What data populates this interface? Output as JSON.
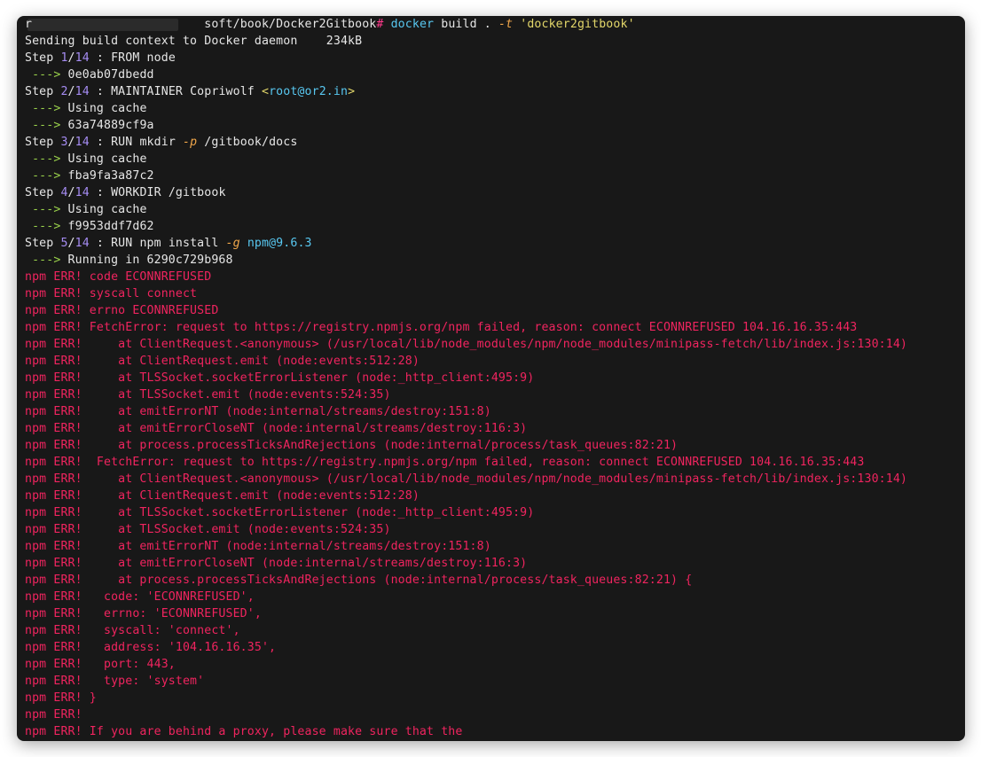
{
  "terminal": {
    "prompt": {
      "user_marker": "r",
      "path": "soft/book/Docker2Gitbook",
      "symbol": "#",
      "command": "docker",
      "args": " build . ",
      "flag": "-t",
      "tag": "'docker2gitbook'"
    },
    "lines": [
      [
        {
          "t": "Sending build context to Docker daemon    234kB",
          "c": "white"
        }
      ],
      [
        {
          "t": "Step ",
          "c": "white"
        },
        {
          "t": "1",
          "c": "purple"
        },
        {
          "t": "/",
          "c": "white"
        },
        {
          "t": "14",
          "c": "purple"
        },
        {
          "t": " : FROM node",
          "c": "white"
        }
      ],
      [
        {
          "t": " ---> ",
          "c": "green"
        },
        {
          "t": "0e0ab07dbedd",
          "c": "white"
        }
      ],
      [
        {
          "t": "Step ",
          "c": "white"
        },
        {
          "t": "2",
          "c": "purple"
        },
        {
          "t": "/",
          "c": "white"
        },
        {
          "t": "14",
          "c": "purple"
        },
        {
          "t": " : MAINTAINER Copriwolf ",
          "c": "white"
        },
        {
          "t": "<",
          "c": "yellow"
        },
        {
          "t": "root@or2.in",
          "c": "cyan"
        },
        {
          "t": ">",
          "c": "yellow"
        }
      ],
      [
        {
          "t": " ---> ",
          "c": "green"
        },
        {
          "t": "Using cache",
          "c": "white"
        }
      ],
      [
        {
          "t": " ---> ",
          "c": "green"
        },
        {
          "t": "63a74889cf9a",
          "c": "white"
        }
      ],
      [
        {
          "t": "Step ",
          "c": "white"
        },
        {
          "t": "3",
          "c": "purple"
        },
        {
          "t": "/",
          "c": "white"
        },
        {
          "t": "14",
          "c": "purple"
        },
        {
          "t": " : RUN mkdir ",
          "c": "white"
        },
        {
          "t": "-p",
          "c": "orange"
        },
        {
          "t": " /gitbook/docs",
          "c": "white"
        }
      ],
      [
        {
          "t": " ---> ",
          "c": "green"
        },
        {
          "t": "Using cache",
          "c": "white"
        }
      ],
      [
        {
          "t": " ---> ",
          "c": "green"
        },
        {
          "t": "fba9fa3a87c2",
          "c": "white"
        }
      ],
      [
        {
          "t": "Step ",
          "c": "white"
        },
        {
          "t": "4",
          "c": "purple"
        },
        {
          "t": "/",
          "c": "white"
        },
        {
          "t": "14",
          "c": "purple"
        },
        {
          "t": " : WORKDIR /gitbook",
          "c": "white"
        }
      ],
      [
        {
          "t": " ---> ",
          "c": "green"
        },
        {
          "t": "Using cache",
          "c": "white"
        }
      ],
      [
        {
          "t": " ---> ",
          "c": "green"
        },
        {
          "t": "f9953ddf7d62",
          "c": "white"
        }
      ],
      [
        {
          "t": "Step ",
          "c": "white"
        },
        {
          "t": "5",
          "c": "purple"
        },
        {
          "t": "/",
          "c": "white"
        },
        {
          "t": "14",
          "c": "purple"
        },
        {
          "t": " : RUN npm install ",
          "c": "white"
        },
        {
          "t": "-g",
          "c": "orange"
        },
        {
          "t": " ",
          "c": "white"
        },
        {
          "t": "npm@9.6.3",
          "c": "cyan"
        }
      ],
      [
        {
          "t": " ---> ",
          "c": "green"
        },
        {
          "t": "Running in 6290c729b968",
          "c": "white"
        }
      ],
      [
        {
          "t": "npm ERR! code ECONNREFUSED",
          "c": "red"
        }
      ],
      [
        {
          "t": "npm ERR! syscall connect",
          "c": "red"
        }
      ],
      [
        {
          "t": "npm ERR! errno ECONNREFUSED",
          "c": "red"
        }
      ],
      [
        {
          "t": "npm ERR! FetchError: request to https://registry.npmjs.org/npm failed, reason: connect ECONNREFUSED 104.16.16.35:443",
          "c": "red"
        }
      ],
      [
        {
          "t": "npm ERR!     at ClientRequest.<anonymous> (/usr/local/lib/node_modules/npm/node_modules/minipass-fetch/lib/index.js:130:14)",
          "c": "red"
        }
      ],
      [
        {
          "t": "npm ERR!     at ClientRequest.emit (node:events:512:28)",
          "c": "red"
        }
      ],
      [
        {
          "t": "npm ERR!     at TLSSocket.socketErrorListener (node:_http_client:495:9)",
          "c": "red"
        }
      ],
      [
        {
          "t": "npm ERR!     at TLSSocket.emit (node:events:524:35)",
          "c": "red"
        }
      ],
      [
        {
          "t": "npm ERR!     at emitErrorNT (node:internal/streams/destroy:151:8)",
          "c": "red"
        }
      ],
      [
        {
          "t": "npm ERR!     at emitErrorCloseNT (node:internal/streams/destroy:116:3)",
          "c": "red"
        }
      ],
      [
        {
          "t": "npm ERR!     at process.processTicksAndRejections (node:internal/process/task_queues:82:21)",
          "c": "red"
        }
      ],
      [
        {
          "t": "npm ERR!  FetchError: request to https://registry.npmjs.org/npm failed, reason: connect ECONNREFUSED 104.16.16.35:443",
          "c": "red"
        }
      ],
      [
        {
          "t": "npm ERR!     at ClientRequest.<anonymous> (/usr/local/lib/node_modules/npm/node_modules/minipass-fetch/lib/index.js:130:14)",
          "c": "red"
        }
      ],
      [
        {
          "t": "npm ERR!     at ClientRequest.emit (node:events:512:28)",
          "c": "red"
        }
      ],
      [
        {
          "t": "npm ERR!     at TLSSocket.socketErrorListener (node:_http_client:495:9)",
          "c": "red"
        }
      ],
      [
        {
          "t": "npm ERR!     at TLSSocket.emit (node:events:524:35)",
          "c": "red"
        }
      ],
      [
        {
          "t": "npm ERR!     at emitErrorNT (node:internal/streams/destroy:151:8)",
          "c": "red"
        }
      ],
      [
        {
          "t": "npm ERR!     at emitErrorCloseNT (node:internal/streams/destroy:116:3)",
          "c": "red"
        }
      ],
      [
        {
          "t": "npm ERR!     at process.processTicksAndRejections (node:internal/process/task_queues:82:21) {",
          "c": "red"
        }
      ],
      [
        {
          "t": "npm ERR!   code: 'ECONNREFUSED',",
          "c": "red"
        }
      ],
      [
        {
          "t": "npm ERR!   errno: 'ECONNREFUSED',",
          "c": "red"
        }
      ],
      [
        {
          "t": "npm ERR!   syscall: 'connect',",
          "c": "red"
        }
      ],
      [
        {
          "t": "npm ERR!   address: '104.16.16.35',",
          "c": "red"
        }
      ],
      [
        {
          "t": "npm ERR!   port: 443,",
          "c": "red"
        }
      ],
      [
        {
          "t": "npm ERR!   type: 'system'",
          "c": "red"
        }
      ],
      [
        {
          "t": "npm ERR! }",
          "c": "red"
        }
      ],
      [
        {
          "t": "npm ERR!",
          "c": "red"
        }
      ],
      [
        {
          "t": "npm ERR! If you are behind a proxy, please make sure that the",
          "c": "red"
        }
      ]
    ]
  }
}
